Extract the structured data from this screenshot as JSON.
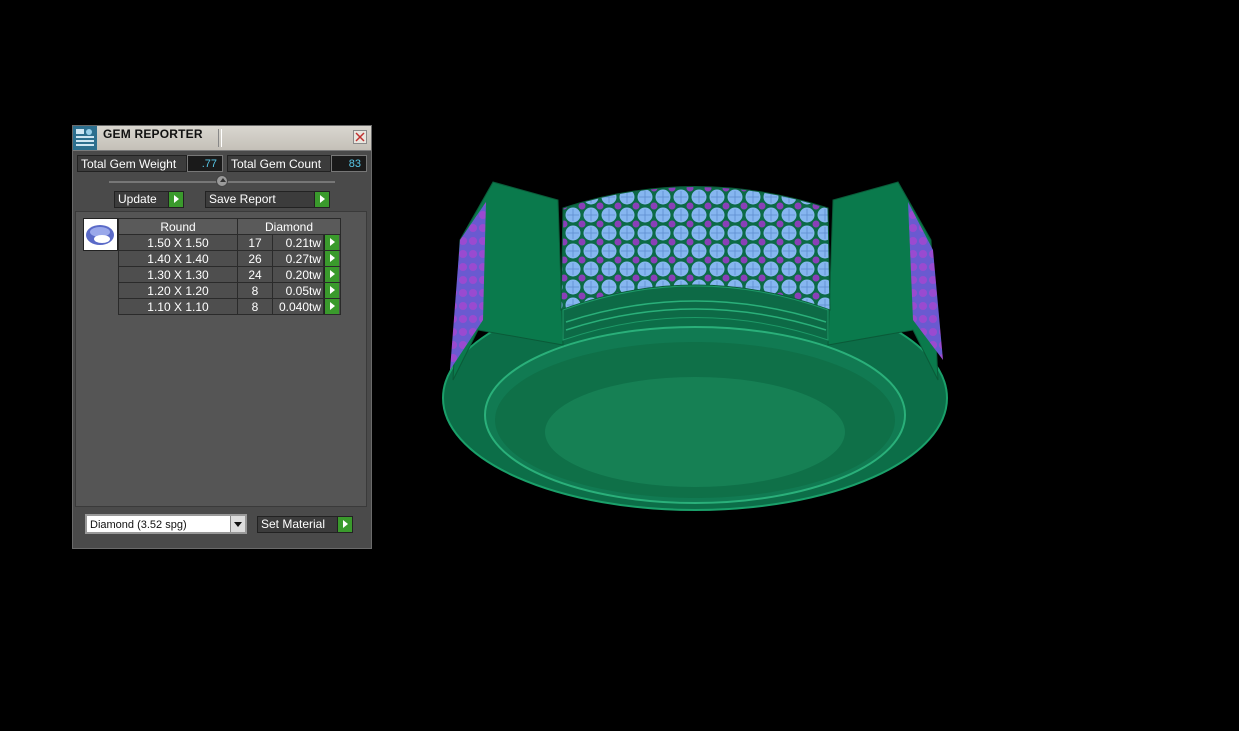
{
  "panel": {
    "title": "GEM REPORTER",
    "total_weight_label": "Total Gem Weight",
    "total_weight_value": ".77",
    "total_count_label": "Total Gem Count",
    "total_count_value": "83",
    "update_label": "Update",
    "save_report_label": "Save Report",
    "table": {
      "headers": [
        "Round",
        "Diamond"
      ],
      "rows": [
        {
          "size": "1.50 X 1.50",
          "count": "17",
          "weight": "0.21tw"
        },
        {
          "size": "1.40 X 1.40",
          "count": "26",
          "weight": "0.27tw"
        },
        {
          "size": "1.30 X 1.30",
          "count": "24",
          "weight": "0.20tw"
        },
        {
          "size": "1.20 X 1.20",
          "count": "8",
          "weight": "0.05tw"
        },
        {
          "size": "1.10 X 1.10",
          "count": "8",
          "weight": "0.040tw"
        }
      ]
    },
    "material_value": "Diamond    (3.52 spg)",
    "set_material_label": "Set Material"
  },
  "colors": {
    "metal": "#0d7a52",
    "gem_primary": "#7fb2ee",
    "gem_secondary": "#8a3fb8",
    "accent_arrow": "#3a9a2c"
  },
  "viewport": {
    "object": "ring-3d-model"
  }
}
